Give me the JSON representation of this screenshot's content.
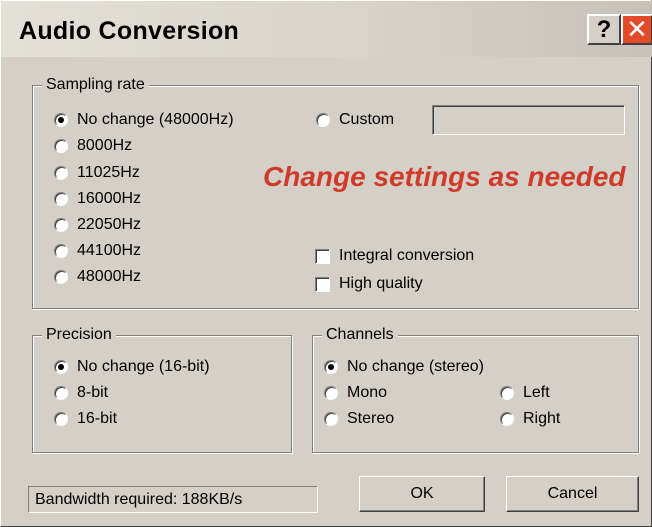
{
  "window": {
    "title": "Audio Conversion",
    "help_glyph": "?",
    "close_glyph": "✕"
  },
  "sampling_rate": {
    "legend": "Sampling rate",
    "options": [
      "No change (48000Hz)",
      "8000Hz",
      "11025Hz",
      "16000Hz",
      "22050Hz",
      "44100Hz",
      "48000Hz"
    ],
    "selected": "No change (48000Hz)",
    "custom_label": "Custom",
    "custom_value": "",
    "integral_conversion_label": "Integral conversion",
    "integral_conversion_checked": false,
    "high_quality_label": "High quality",
    "high_quality_checked": false
  },
  "hint_text": "Change settings as needed",
  "precision": {
    "legend": "Precision",
    "options": [
      "No change (16-bit)",
      "8-bit",
      "16-bit"
    ],
    "selected": "No change (16-bit)"
  },
  "channels": {
    "legend": "Channels",
    "options": [
      "No change (stereo)",
      "Mono",
      "Left",
      "Stereo",
      "Right"
    ],
    "selected": "No change (stereo)"
  },
  "status_text": "Bandwidth required: 188KB/s",
  "buttons": {
    "ok": "OK",
    "cancel": "Cancel"
  },
  "colors": {
    "hint": "#d03a2a",
    "dialog_bg": "#d4d0c8",
    "close_button": "#e24a2a"
  }
}
